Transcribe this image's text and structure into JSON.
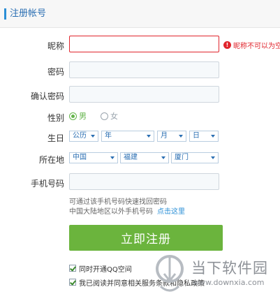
{
  "header": {
    "title": "注册帐号"
  },
  "form": {
    "nickname": {
      "label": "昵称",
      "value": "",
      "error": "昵称不可以为空",
      "error_icon": "alert-icon"
    },
    "password": {
      "label": "密码",
      "value": ""
    },
    "confirm_password": {
      "label": "确认密码",
      "value": ""
    },
    "gender": {
      "label": "性别",
      "options": [
        "男",
        "女"
      ],
      "selected": "男"
    },
    "birthday": {
      "label": "生日",
      "calendar": "公历",
      "year": "年",
      "month": "月",
      "day": "日"
    },
    "location": {
      "label": "所在地",
      "country": "中国",
      "province": "福建",
      "city": "厦门"
    },
    "phone": {
      "label": "手机号码",
      "value": "",
      "hint_line1": "可通过该手机号码快速找回密码",
      "hint_line2": "中国大陆地区以外手机号码",
      "hint_link": "点击这里"
    }
  },
  "register_button": {
    "label": "立即注册",
    "color": "#6bb43d"
  },
  "checkboxes": [
    {
      "label": "同时开通QQ空间",
      "checked": true
    },
    {
      "label": "我已阅读并同意相关服务条款和隐私政策",
      "checked": true
    }
  ],
  "watermark": {
    "title": "当下软件园",
    "url": "www.downxia.com"
  },
  "colors": {
    "accent": "#2b8fd6",
    "error": "#e0242c",
    "selected_radio": "#64b44b"
  }
}
